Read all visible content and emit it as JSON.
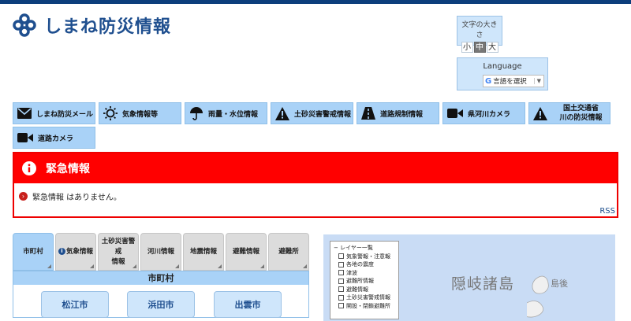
{
  "header": {
    "site_title": "しまね防災情報"
  },
  "fontsize": {
    "label": "文字の大きさ",
    "small": "小",
    "medium": "中",
    "large": "大"
  },
  "language": {
    "title": "Language",
    "select_label": "言語を選択",
    "arrow": "▼"
  },
  "nav": {
    "items": [
      {
        "label": "しまね防災メール",
        "icon": "mail-icon"
      },
      {
        "label": "気象情報等",
        "icon": "sun-icon"
      },
      {
        "label": "雨量・水位情報",
        "icon": "umbrella-icon"
      },
      {
        "label": "土砂災害警戒情報",
        "icon": "warning-icon"
      },
      {
        "label": "道路規制情報",
        "icon": "road-icon"
      },
      {
        "label": "県河川カメラ",
        "icon": "video-camera-icon"
      },
      {
        "label_line1": "国土交通省",
        "label_line2": "川の防災情報",
        "icon": "warning-icon"
      },
      {
        "label": "道路カメラ",
        "icon": "video-camera-icon"
      }
    ]
  },
  "alert": {
    "title": "緊急情報",
    "message": "緊急情報 はありません。",
    "rss": "RSS",
    "color": "#ff0000"
  },
  "tabs": [
    {
      "label": "市町村",
      "active": true
    },
    {
      "label": "気象情報",
      "has_info_icon": true
    },
    {
      "label_line1": "土砂災害警戒",
      "label_line2": "情報"
    },
    {
      "label": "河川情報"
    },
    {
      "label": "地震情報"
    },
    {
      "label": "避難情報"
    },
    {
      "label": "避難所"
    }
  ],
  "city_panel": {
    "title": "市町村",
    "cities": [
      "松江市",
      "浜田市",
      "出雲市"
    ]
  },
  "map": {
    "layer_title": "レイヤー一覧",
    "layers": [
      "気象警報・注意報",
      "各地の震度",
      "津波",
      "避難所情報",
      "避難情報",
      "土砂災害警戒情報",
      "開設・閉鎖避難所"
    ],
    "label_main": "隠岐諸島",
    "label_sub": "島後"
  },
  "colors": {
    "brand": "#1f4f8f",
    "nav_bg": "#a9d2f7",
    "alert": "#ff0000"
  }
}
